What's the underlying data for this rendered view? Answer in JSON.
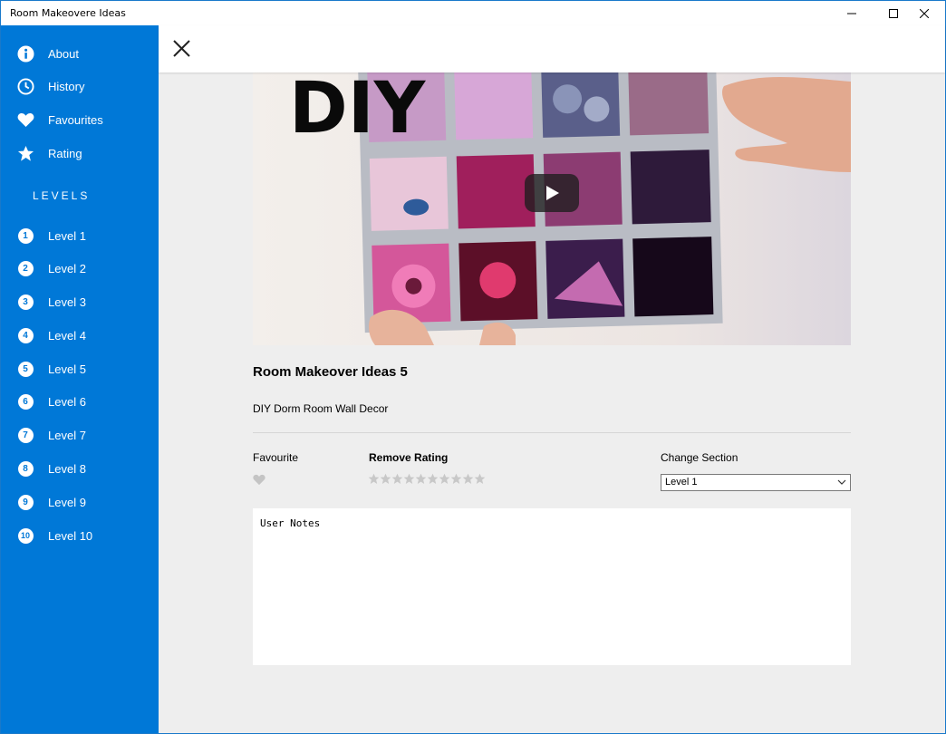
{
  "window": {
    "title": "Room Makeovere Ideas"
  },
  "sidebar": {
    "items": [
      {
        "label": "About",
        "icon": "info-icon"
      },
      {
        "label": "History",
        "icon": "clock-icon"
      },
      {
        "label": "Favourites",
        "icon": "heart-icon"
      },
      {
        "label": "Rating",
        "icon": "star-icon"
      }
    ],
    "levels_heading": "LEVELS",
    "levels": [
      {
        "number": "1",
        "label": "Level 1"
      },
      {
        "number": "2",
        "label": "Level 2"
      },
      {
        "number": "3",
        "label": "Level 3"
      },
      {
        "number": "4",
        "label": "Level 4"
      },
      {
        "number": "5",
        "label": "Level 5"
      },
      {
        "number": "6",
        "label": "Level 6"
      },
      {
        "number": "7",
        "label": "Level 7"
      },
      {
        "number": "8",
        "label": "Level 8"
      },
      {
        "number": "9",
        "label": "Level 9"
      },
      {
        "number": "10",
        "label": "Level 10"
      }
    ],
    "color": "#0078d7"
  },
  "video": {
    "overlay_text": "DIY"
  },
  "detail": {
    "title": "Room Makeover Ideas 5",
    "description": "DIY Dorm Room Wall Decor",
    "favourite_label": "Favourite",
    "rating_label": "Remove Rating",
    "rating_value": 0,
    "rating_max": 10,
    "section_label": "Change Section",
    "section_selected": "Level 1",
    "notes_placeholder": "User Notes"
  }
}
